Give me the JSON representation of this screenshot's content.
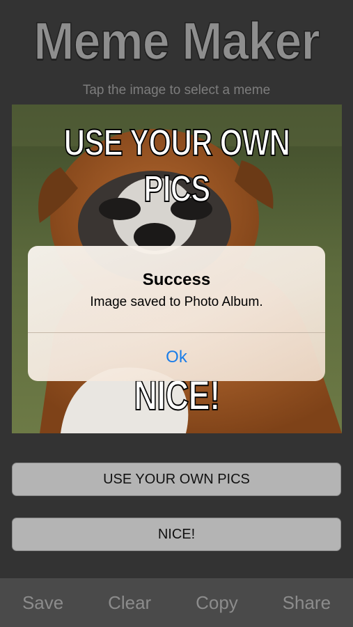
{
  "app": {
    "title": "Meme Maker",
    "hint": "Tap the image to select a meme"
  },
  "meme": {
    "top_text": "USE YOUR OWN PICS",
    "bottom_text": "NICE!"
  },
  "inputs": {
    "line1": "USE YOUR OWN PICS",
    "line2": "NICE!"
  },
  "toolbar": {
    "save": "Save",
    "clear": "Clear",
    "copy": "Copy",
    "share": "Share"
  },
  "alert": {
    "title": "Success",
    "message": "Image saved to Photo Album.",
    "ok": "Ok"
  },
  "colors": {
    "background": "#333333",
    "toolbar": "#4a4a4a",
    "alert_button": "#1a7de8"
  }
}
